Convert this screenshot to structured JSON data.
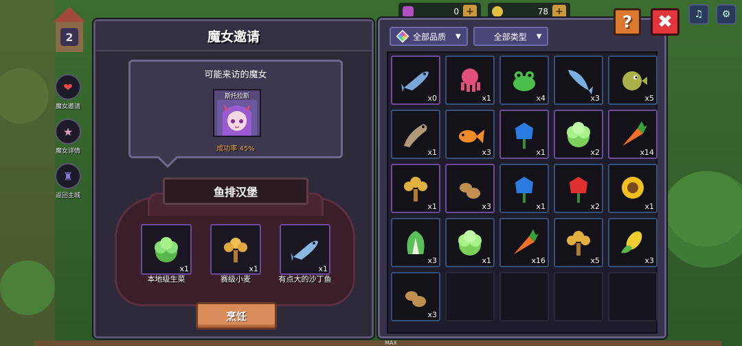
{
  "hud": {
    "house_level": "2",
    "res1_value": "0",
    "res2_value": "78"
  },
  "side_menu": [
    {
      "label": "魔女邀请",
      "icon": "heart-icon"
    },
    {
      "label": "魔女详情",
      "icon": "witch-detail-icon"
    },
    {
      "label": "返回主城",
      "icon": "castle-icon"
    }
  ],
  "invite_panel": {
    "title": "魔女邀请",
    "visitor_heading": "可能来访的魔女",
    "witch_name": "斯托拉斯",
    "success_rate": "成功率 45%",
    "recipe_name": "鱼排汉堡",
    "ingredients": [
      {
        "name": "本地级生菜",
        "count": "x1",
        "icon": "lettuce-icon"
      },
      {
        "name": "赛级小麦",
        "count": "x1",
        "icon": "wheat-icon"
      },
      {
        "name": "有点大的沙丁鱼",
        "count": "x1",
        "icon": "sardine-icon"
      }
    ],
    "cook_label": "烹饪"
  },
  "inventory": {
    "filter_quality": "全部品质",
    "filter_type": "全部类型",
    "items": [
      {
        "icon": "sardine-icon",
        "count": "x0",
        "rarity": "purple",
        "color": "#7aa7d8"
      },
      {
        "icon": "octopus-icon",
        "count": "x1",
        "rarity": "blue",
        "color": "#e0507a"
      },
      {
        "icon": "frog-icon",
        "count": "x4",
        "rarity": "blue",
        "color": "#4ac04a"
      },
      {
        "icon": "dolphin-fish-icon",
        "count": "x3",
        "rarity": "blue",
        "color": "#7ab0e0"
      },
      {
        "icon": "pufferfish-icon",
        "count": "x5",
        "rarity": "blue",
        "color": "#a8b04a"
      },
      {
        "icon": "catfish-icon",
        "count": "x1",
        "rarity": "blue",
        "color": "#b09a7a"
      },
      {
        "icon": "goldfish-icon",
        "count": "x3",
        "rarity": "blue",
        "color": "#f08a2a"
      },
      {
        "icon": "blue-flower-icon",
        "count": "x1",
        "rarity": "purple",
        "color": "#2a7ae0"
      },
      {
        "icon": "lettuce-icon",
        "count": "x2",
        "rarity": "purple",
        "color": "#7ad05a"
      },
      {
        "icon": "carrot-icon",
        "count": "x14",
        "rarity": "purple",
        "color": "#f0702a"
      },
      {
        "icon": "wheat-icon",
        "count": "x1",
        "rarity": "purple",
        "color": "#e0b040"
      },
      {
        "icon": "potato-icon",
        "count": "x3",
        "rarity": "purple",
        "color": "#c09050"
      },
      {
        "icon": "blue-flower-icon",
        "count": "x1",
        "rarity": "blue",
        "color": "#2a7ae0"
      },
      {
        "icon": "red-flower-icon",
        "count": "x2",
        "rarity": "blue",
        "color": "#e03030"
      },
      {
        "icon": "sunflower-icon",
        "count": "x1",
        "rarity": "blue",
        "color": "#f0c020"
      },
      {
        "icon": "bok-choy-icon",
        "count": "x3",
        "rarity": "blue",
        "color": "#5ac05a"
      },
      {
        "icon": "lettuce-icon",
        "count": "x1",
        "rarity": "blue",
        "color": "#7ad05a"
      },
      {
        "icon": "carrot-icon",
        "count": "x16",
        "rarity": "blue",
        "color": "#f0702a"
      },
      {
        "icon": "wheat-icon",
        "count": "x5",
        "rarity": "blue",
        "color": "#e0b040"
      },
      {
        "icon": "corn-icon",
        "count": "x3",
        "rarity": "blue",
        "color": "#f0d030"
      },
      {
        "icon": "potato-icon",
        "count": "x3",
        "rarity": "blue",
        "color": "#c09050"
      }
    ],
    "empty_slots": 4
  },
  "bottom_label": "MAX",
  "colors": {
    "panel_bg": "#2e2a3a",
    "accent_orange": "#d98c5a",
    "close_red": "#e0353a",
    "rate_orange": "#f0a040"
  }
}
